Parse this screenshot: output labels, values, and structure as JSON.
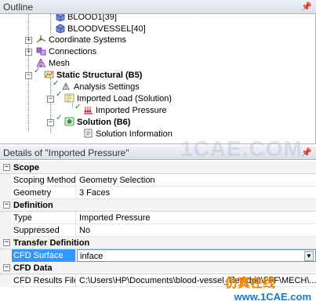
{
  "outline": {
    "title": "Outline",
    "pin_glyph": "ᵖ",
    "rows": [
      {
        "label": "BLOOD1[39]"
      },
      {
        "label": "BLOODVESSEL[40]"
      },
      {
        "label": "Coordinate Systems"
      },
      {
        "label": "Connections"
      },
      {
        "label": "Mesh"
      },
      {
        "label": "Static Structural (B5)"
      },
      {
        "label": "Analysis Settings"
      },
      {
        "label": "Imported Load (Solution)"
      },
      {
        "label": "Imported Pressure"
      },
      {
        "label": "Solution (B6)"
      },
      {
        "label": "Solution Information"
      }
    ]
  },
  "details": {
    "title": "Details of \"Imported Pressure\"",
    "pin_glyph": "ᵖ",
    "sections": [
      {
        "name": "Scope",
        "rows": [
          {
            "key": "Scoping Method",
            "value": "Geometry Selection"
          },
          {
            "key": "Geometry",
            "value": "3 Faces"
          }
        ]
      },
      {
        "name": "Definition",
        "rows": [
          {
            "key": "Type",
            "value": "Imported Pressure"
          },
          {
            "key": "Suppressed",
            "value": "No"
          }
        ]
      },
      {
        "name": "Transfer Definition",
        "rows": [
          {
            "key": "CFD Surface",
            "value": "inface"
          }
        ]
      },
      {
        "name": "CFD Data",
        "rows": [
          {
            "key": "CFD Results File",
            "value": "C:\\Users\\HP\\Documents\\blood-vessel_files\\dp0\\FFF\\MECH\\..."
          }
        ]
      }
    ]
  },
  "watermark": {
    "text": "1CAE.COM",
    "site": "www.1CAE.com",
    "cn": "仿真在线"
  },
  "colors": {
    "selection": "#3399ff",
    "check": "#1a8a1a",
    "brand_blue": "#1f78c8",
    "brand_orange": "#f08300"
  }
}
